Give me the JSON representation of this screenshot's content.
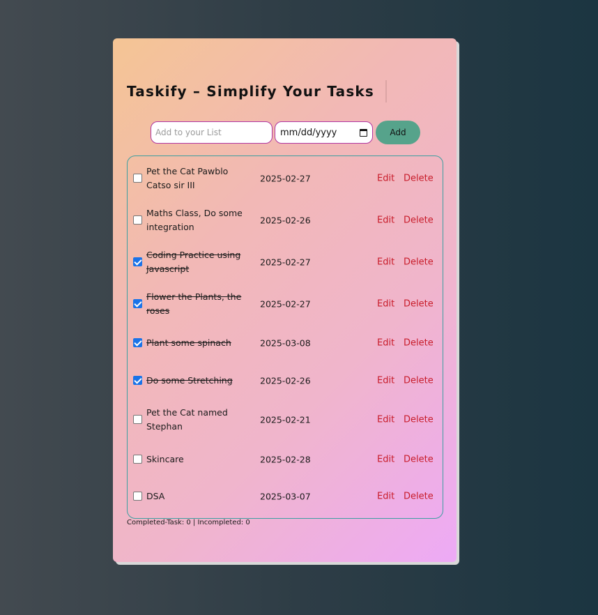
{
  "app": {
    "title": "Taskify – Simplify Your Tasks"
  },
  "add_form": {
    "task_placeholder": "Add to your List",
    "date_placeholder": "mm/dd/yyyy",
    "add_label": "Add"
  },
  "tasks": [
    {
      "text": "Pet the Cat Pawblo Catso sir III",
      "date": "2025-02-27",
      "done": false,
      "edit": "Edit",
      "delete": "Delete"
    },
    {
      "text": "Maths Class, Do some integration",
      "date": "2025-02-26",
      "done": false,
      "edit": "Edit",
      "delete": "Delete"
    },
    {
      "text": "Coding Practice using Javascript",
      "date": "2025-02-27",
      "done": true,
      "edit": "Edit",
      "delete": "Delete"
    },
    {
      "text": "Flower the Plants, the roses",
      "date": "2025-02-27",
      "done": true,
      "edit": "Edit",
      "delete": "Delete"
    },
    {
      "text": "Plant some spinach",
      "date": "2025-03-08",
      "done": true,
      "edit": "Edit",
      "delete": "Delete"
    },
    {
      "text": "Do some Stretching",
      "date": "2025-02-26",
      "done": true,
      "edit": "Edit",
      "delete": "Delete"
    },
    {
      "text": "Pet the Cat named Stephan",
      "date": "2025-02-21",
      "done": false,
      "edit": "Edit",
      "delete": "Delete"
    },
    {
      "text": "Skincare",
      "date": "2025-02-28",
      "done": false,
      "edit": "Edit",
      "delete": "Delete"
    },
    {
      "text": "DSA",
      "date": "2025-03-07",
      "done": false,
      "edit": "Edit",
      "delete": "Delete"
    }
  ],
  "footer": {
    "counter": "Completed-Task: 0 | Incompleted: 0"
  }
}
